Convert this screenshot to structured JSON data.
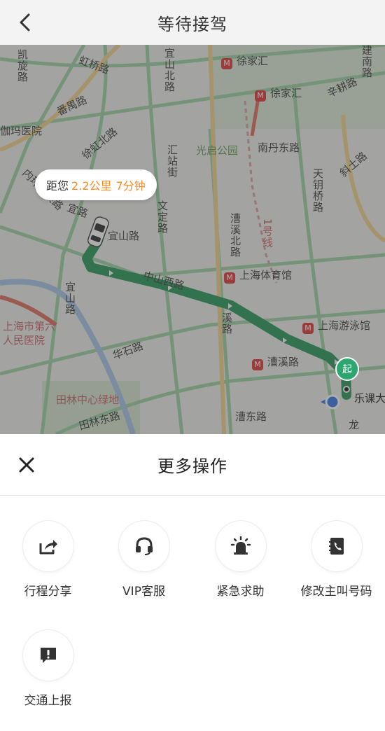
{
  "header": {
    "title": "等待接驾"
  },
  "map": {
    "eta": {
      "prefix": "距您",
      "distance": "2.2公里",
      "time": "7分钟"
    },
    "start_marker": "起",
    "labels": {
      "hongqiao": "虹桥路",
      "yishanbei": "宜山北路",
      "xujiahui1": "徐家汇",
      "xujiahui2": "徐家汇",
      "xinggeng": "辛耕路",
      "jianan": "建南路",
      "fanyu": "番禺路",
      "xuhongbei": "徐虹北路",
      "huizhan": "汇站街",
      "guangqi": "光启公园",
      "nandan": "南丹东路",
      "tianyao": "天钥桥路",
      "xieyi": "斜土路",
      "wending": "文定路",
      "yishan_station": "宜山路",
      "yiyi": "宜路",
      "caoxibei": "漕溪北路",
      "line1": "1号线",
      "tiyuguan": "上海体育馆",
      "zhongshan": "中山西路",
      "youyongguan": "上海游泳馆",
      "yishan_road": "宜山路",
      "hospital": "上海市第六人民医院",
      "caoxi_road": "溪路",
      "huashi": "华石路",
      "caoxi_station": "漕溪路",
      "tianlin": "田林中心绿地",
      "tianlindong": "田林东路",
      "caodong": "漕东路",
      "lekecheng": "乐课大",
      "long": "龙",
      "neihuan": "内环高架路",
      "xiamayiyuan": "伽玛医院",
      "quanhong": "凯旋路"
    }
  },
  "sheet": {
    "title": "更多操作",
    "actions": [
      {
        "label": "行程分享",
        "icon": "share-icon"
      },
      {
        "label": "VIP客服",
        "icon": "headset-icon"
      },
      {
        "label": "紧急求助",
        "icon": "siren-icon"
      },
      {
        "label": "修改主叫号码",
        "icon": "contact-book-icon"
      },
      {
        "label": "交通上报",
        "icon": "report-icon"
      }
    ]
  }
}
